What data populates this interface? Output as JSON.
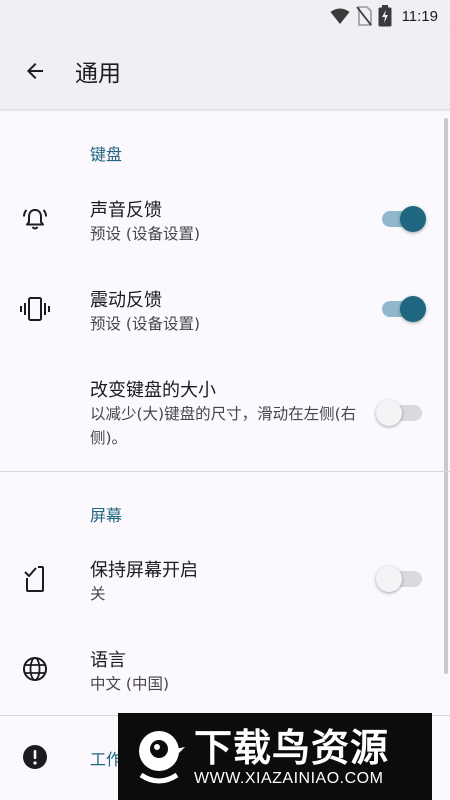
{
  "status_bar": {
    "time": "11:19"
  },
  "app_bar": {
    "title": "通用"
  },
  "sections": {
    "keyboard": {
      "header": "键盘",
      "sound_feedback": {
        "title": "声音反馈",
        "subtitle": "预设 (设备设置)",
        "enabled": true
      },
      "vibration_feedback": {
        "title": "震动反馈",
        "subtitle": "预设 (设备设置)",
        "enabled": true
      },
      "resize_keyboard": {
        "title": "改变键盘的大小",
        "subtitle": "以减少(大)键盘的尺寸，滑动在左侧(右侧)。",
        "enabled": false
      }
    },
    "screen": {
      "header": "屏幕",
      "keep_screen_on": {
        "title": "保持屏幕开启",
        "subtitle": "关",
        "enabled": false
      },
      "language": {
        "title": "语言",
        "subtitle": "中文 (中国)"
      }
    },
    "partial": {
      "header": "工作"
    }
  },
  "watermark": {
    "brand": "下载鸟资源",
    "url": "WWW.XIAZAINIAO.COM"
  },
  "colors": {
    "accent": "#1f6680",
    "track_on": "#8fb7cd",
    "track_off": "#dbd9de",
    "background": "#fbf9fd",
    "app_bar": "#f1eff5"
  }
}
